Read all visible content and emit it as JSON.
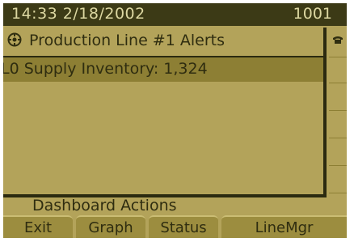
{
  "status_bar": {
    "datetime": "14:33 2/18/2002",
    "line_number": "1001"
  },
  "alert_panel": {
    "icon": "gear-icon",
    "title": "Production Line #1 Alerts",
    "items": [
      {
        "text": "L0 Supply Inventory: 1,324"
      }
    ]
  },
  "side_icon": "phone-icon",
  "actions": {
    "label": "Dashboard Actions"
  },
  "softkeys": [
    {
      "label": "Exit"
    },
    {
      "label": "Graph"
    },
    {
      "label": "Status"
    },
    {
      "label": "LineMgr"
    }
  ],
  "colors": {
    "screen_bg": "#b3a35a",
    "status_bar_bg": "#3c3a16",
    "highlight": "#8d7f34",
    "text": "#2f2d10"
  }
}
